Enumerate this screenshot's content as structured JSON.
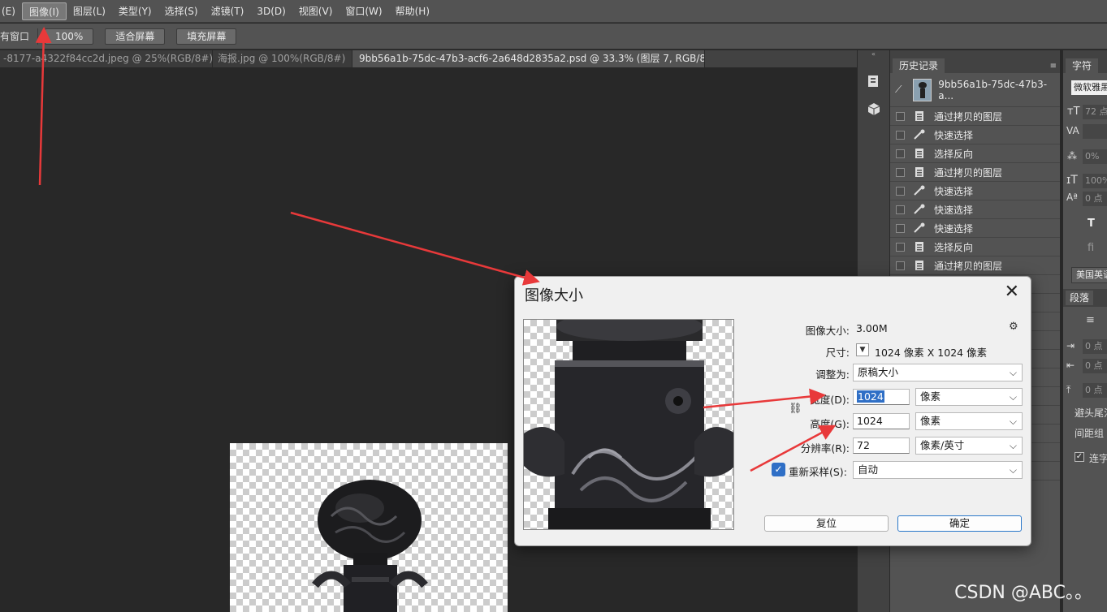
{
  "menu": {
    "items": [
      {
        "label": "(E)"
      },
      {
        "label": "图像(I)",
        "active": true
      },
      {
        "label": "图层(L)"
      },
      {
        "label": "类型(Y)"
      },
      {
        "label": "选择(S)"
      },
      {
        "label": "滤镜(T)"
      },
      {
        "label": "3D(D)"
      },
      {
        "label": "视图(V)"
      },
      {
        "label": "窗口(W)"
      },
      {
        "label": "帮助(H)"
      }
    ]
  },
  "options": {
    "left_text": "有窗口",
    "zoom_button": "100%",
    "fit_button": "适合屏幕",
    "fill_button": "填充屏幕"
  },
  "tabs": [
    {
      "label": "-8177-a4322f84cc2d.jpeg @ 25%(RGB/8#)",
      "close": "×"
    },
    {
      "label": "海报.jpg @ 100%(RGB/8#)",
      "close": "×"
    },
    {
      "label": "9bb56a1b-75dc-47b3-acf6-2a648d2835a2.psd @ 33.3% (图层 7, RGB/8#) *",
      "close": "×"
    }
  ],
  "history_panel": {
    "tab_label": "历史记录",
    "snapshot_label": "9bb56a1b-75dc-47b3-a...",
    "items": [
      {
        "label": "通过拷贝的图层",
        "icon": "document-icon"
      },
      {
        "label": "快速选择",
        "icon": "brush-icon"
      },
      {
        "label": "选择反向",
        "icon": "document-icon"
      },
      {
        "label": "通过拷贝的图层",
        "icon": "document-icon"
      },
      {
        "label": "快速选择",
        "icon": "brush-icon"
      },
      {
        "label": "快速选择",
        "icon": "brush-icon"
      },
      {
        "label": "快速选择",
        "icon": "brush-icon"
      },
      {
        "label": "选择反向",
        "icon": "document-icon"
      },
      {
        "label": "通过拷贝的图层",
        "icon": "document-icon"
      }
    ]
  },
  "char_panel": {
    "tab_label": "字符",
    "font_family": "微软雅黑",
    "font_size": "72 点",
    "tracking": "0%",
    "scale": "100%",
    "baseline": "0 点",
    "language": "美国英语",
    "para_tab": "段落",
    "indent1": "0 点",
    "indent2": "0 点",
    "indent3": "0 点",
    "avoid": "避头尾法",
    "spacing": "间距组",
    "hyphen": "连字"
  },
  "dialog": {
    "title": "图像大小",
    "close_glyph": "✕",
    "image_size_label": "图像大小:",
    "image_size_value": "3.00M",
    "dimensions_label": "尺寸:",
    "dimensions_value": "1024 像素  X  1024 像素",
    "fit_to_label": "调整为:",
    "fit_to_value": "原稿大小",
    "width_label": "宽度(D):",
    "width_value": "1024",
    "width_unit": "像素",
    "height_label": "高度(G):",
    "height_value": "1024",
    "height_unit": "像素",
    "resolution_label": "分辨率(R):",
    "resolution_value": "72",
    "resolution_unit": "像素/英寸",
    "resample_label": "重新采样(S):",
    "resample_checked": true,
    "resample_value": "自动",
    "reset_button": "复位",
    "ok_button": "确定",
    "chevron": "⌵"
  },
  "watermark": "CSDN @ABC。。",
  "colors": {
    "arrow": "#e8393a",
    "accent": "#2f6fc6"
  }
}
